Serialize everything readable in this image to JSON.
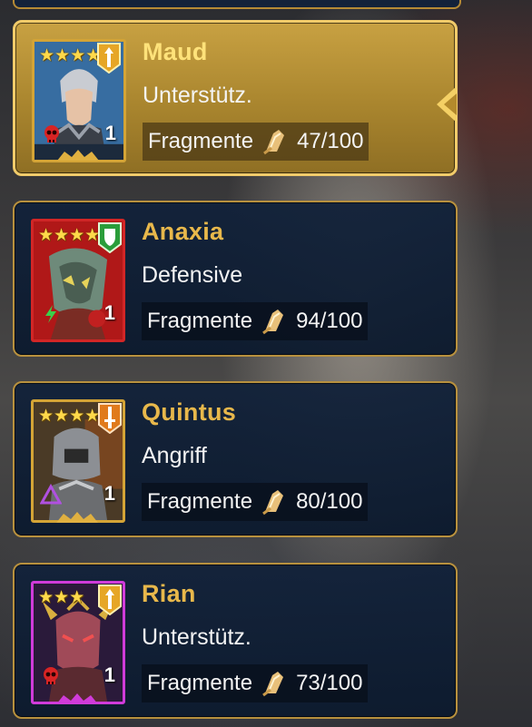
{
  "fragment_label": "Fragmente",
  "champions": [
    {
      "name": "Maud",
      "role": "Unterstütz.",
      "stars": 4,
      "level": "1",
      "fragments": "47/100",
      "rarity": "legendary",
      "role_icon": "support-icon",
      "affinity_icon": "skull-icon",
      "selected": true
    },
    {
      "name": "Anaxia",
      "role": "Defensive",
      "stars": 5,
      "level": "1",
      "fragments": "94/100",
      "rarity": "mythical",
      "role_icon": "shield-icon",
      "affinity_icon": "force-icon",
      "selected": false
    },
    {
      "name": "Quintus",
      "role": "Angriff",
      "stars": 4,
      "level": "1",
      "fragments": "80/100",
      "rarity": "legendary",
      "role_icon": "sword-icon",
      "affinity_icon": "magic-icon",
      "selected": false
    },
    {
      "name": "Rian",
      "role": "Unterstütz.",
      "stars": 3,
      "level": "1",
      "fragments": "73/100",
      "rarity": "epic",
      "role_icon": "support-icon",
      "affinity_icon": "skull-icon",
      "selected": false
    }
  ],
  "colors": {
    "gold": "#e8b84b",
    "card_bg": "#12223a",
    "selected_bg": "#b8913e",
    "support_badge": "#e6a626",
    "defense_badge": "#2a9d3a",
    "attack_badge": "#e07a1c"
  }
}
